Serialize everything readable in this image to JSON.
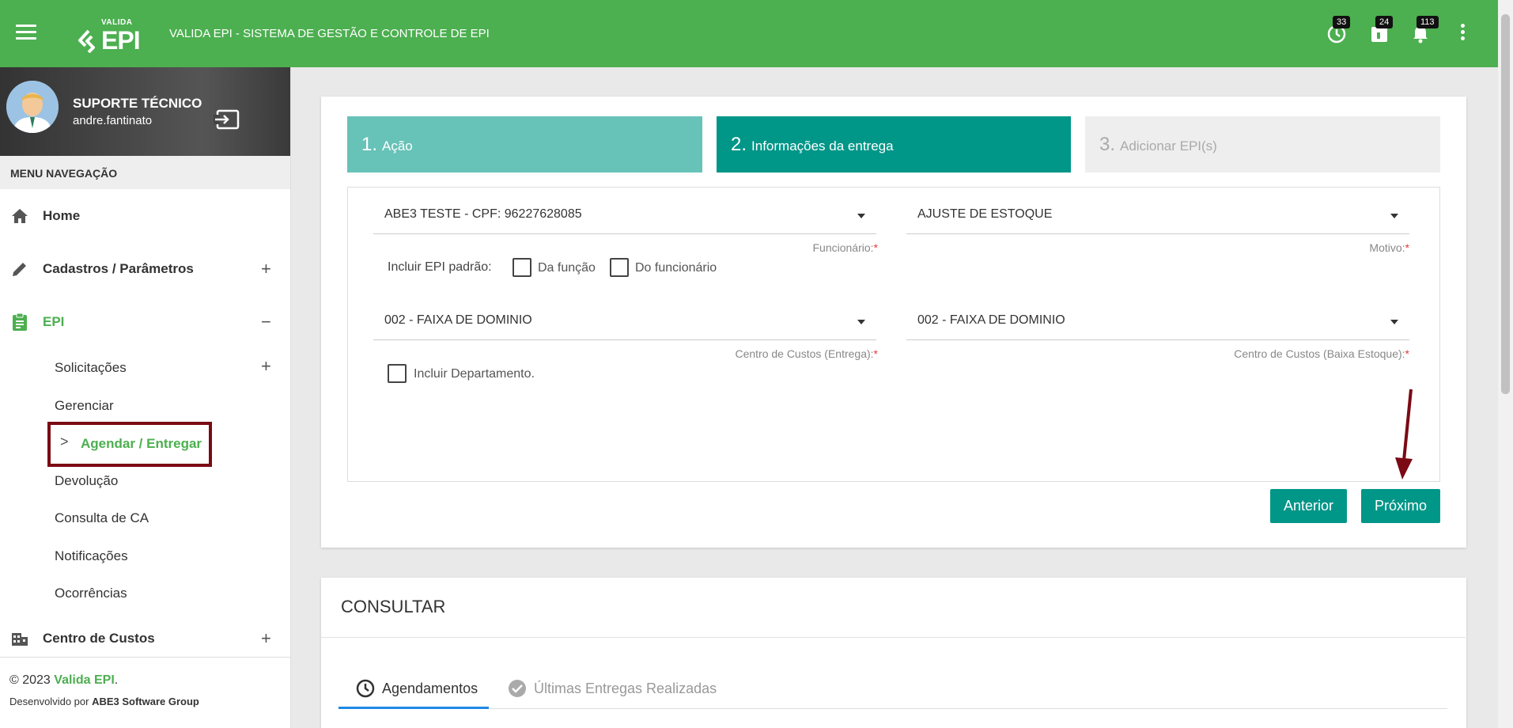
{
  "header": {
    "logo_small": "VALIDA",
    "logo_big": "EPI",
    "title": "VALIDA EPI - SISTEMA DE GESTÃO E CONTROLE DE EPI",
    "badges": {
      "clock": "33",
      "calendar": "24",
      "bell": "113"
    }
  },
  "profile": {
    "name": "SUPORTE TÉCNICO",
    "username": "andre.fantinato"
  },
  "menu": {
    "heading": "MENU NAVEGAÇÃO",
    "items": [
      {
        "label": "Home",
        "expander": ""
      },
      {
        "label": "Cadastros / Parâmetros",
        "expander": "+"
      },
      {
        "label": "EPI",
        "expander": "−"
      },
      {
        "label": "Centro de Custos",
        "expander": "+"
      }
    ],
    "epi_sub": [
      {
        "label": "Solicitações",
        "expander": "+"
      },
      {
        "label": "Gerenciar"
      },
      {
        "label": "Agendar / Entregar"
      },
      {
        "label": "Devolução"
      },
      {
        "label": "Consulta de CA"
      },
      {
        "label": "Notificações"
      },
      {
        "label": "Ocorrências"
      }
    ],
    "chevron": ">"
  },
  "footer": {
    "copy_prefix": "© 2023 ",
    "brand": "Valida EPI",
    "copy_suffix": ".",
    "dev_prefix": "Desenvolvido por ",
    "dev_company": "ABE3 Software Group"
  },
  "wizard": {
    "steps": [
      {
        "num": "1.",
        "label": "Ação"
      },
      {
        "num": "2.",
        "label": "Informações da entrega"
      },
      {
        "num": "3.",
        "label": "Adicionar EPI(s)"
      }
    ],
    "fields": {
      "funcionario": {
        "value": "ABE3 TESTE - CPF: 96227628085",
        "label": "Funcionário:",
        "req": "*"
      },
      "motivo": {
        "value": "AJUSTE DE ESTOQUE",
        "label": "Motivo:",
        "req": "*"
      },
      "cc_entrega": {
        "value": "002 - FAIXA DE DOMINIO",
        "label": "Centro de Custos (Entrega):",
        "req": "*"
      },
      "cc_baixa": {
        "value": "002 - FAIXA DE DOMINIO",
        "label": "Centro de Custos (Baixa Estoque):",
        "req": "*"
      }
    },
    "include_epi_label": "Incluir EPI padrão:",
    "chk_funcao": "Da função",
    "chk_funcionario": "Do funcionário",
    "chk_departamento": "Incluir Departamento.",
    "btn_prev": "Anterior",
    "btn_next": "Próximo"
  },
  "consultar": {
    "title": "CONSULTAR",
    "tabs": [
      {
        "label": "Agendamentos"
      },
      {
        "label": "Últimas Entregas Realizadas"
      }
    ]
  },
  "colors": {
    "green": "#4caf50",
    "teal": "#009688",
    "teal_light": "#67c2b8",
    "step_inactive": "#eeeeee",
    "highlight": "#7b0a14",
    "arrow": "#7b0a14"
  }
}
